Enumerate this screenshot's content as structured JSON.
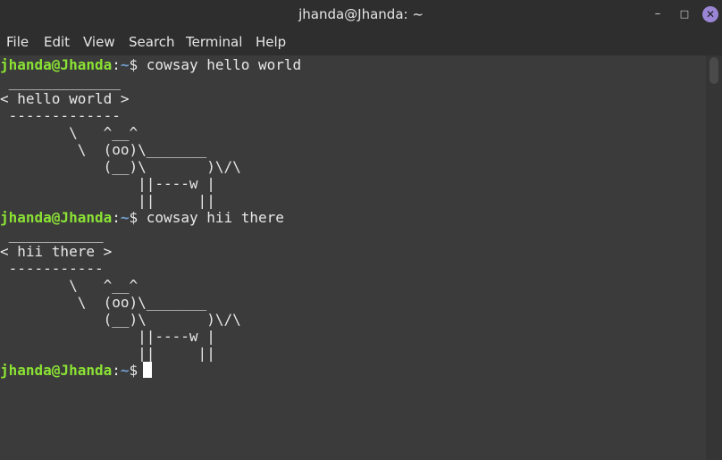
{
  "window": {
    "title": "jhanda@Jhanda: ~",
    "minimize_glyph": "–",
    "maximize_glyph": "□",
    "close_glyph": "✕"
  },
  "menu": {
    "file": "File",
    "edit": "Edit",
    "view": "View",
    "search": "Search",
    "terminal": "Terminal",
    "help": "Help"
  },
  "colors": {
    "prompt_user_host": "#8ae234",
    "prompt_path": "#729fcf",
    "background": "#3b3b3b",
    "close_button": "#9b86d6"
  },
  "terminal": {
    "prompts": [
      {
        "user_host": "jhanda@Jhanda",
        "colon": ":",
        "path": "~",
        "symbol": "$",
        "command": " cowsay hello world"
      },
      {
        "user_host": "jhanda@Jhanda",
        "colon": ":",
        "path": "~",
        "symbol": "$",
        "command": " cowsay hii there"
      },
      {
        "user_host": "jhanda@Jhanda",
        "colon": ":",
        "path": "~",
        "symbol": "$",
        "command": ""
      }
    ],
    "output1": [
      " _____________",
      "< hello world >",
      " -------------",
      "        \\   ^__^",
      "         \\  (oo)\\_______",
      "            (__)\\       )\\/\\",
      "                ||----w |",
      "                ||     ||"
    ],
    "output2": [
      " ___________",
      "< hii there >",
      " -----------",
      "        \\   ^__^",
      "         \\  (oo)\\_______",
      "            (__)\\       )\\/\\",
      "                ||----w |",
      "                ||     ||"
    ]
  }
}
